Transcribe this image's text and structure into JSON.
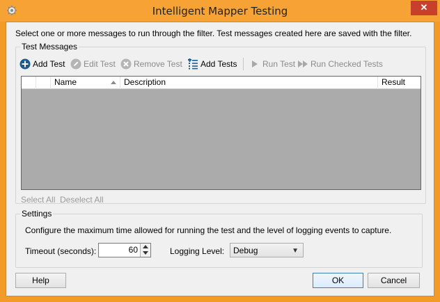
{
  "window": {
    "title": "Intelligent Mapper Testing",
    "close_glyph": "✕"
  },
  "intro_text": "Select one or more messages to run through the filter. Test messages created here are saved with the filter.",
  "test_messages": {
    "group_title": "Test Messages",
    "toolbar": {
      "add_test": "Add Test",
      "edit_test": "Edit Test",
      "remove_test": "Remove Test",
      "add_tests": "Add Tests",
      "run_test": "Run Test",
      "run_checked_tests": "Run Checked Tests"
    },
    "columns": {
      "name": "Name",
      "description": "Description",
      "result": "Result"
    },
    "rows": [],
    "select_all": "Select All",
    "deselect_all": "Deselect All"
  },
  "settings": {
    "group_title": "Settings",
    "description": "Configure the maximum time allowed for running the test and the level of logging events to capture.",
    "timeout_label": "Timeout (seconds):",
    "timeout_value": "60",
    "logging_label": "Logging Level:",
    "logging_value": "Debug"
  },
  "buttons": {
    "help": "Help",
    "ok": "OK",
    "cancel": "Cancel"
  },
  "icons": {
    "app": "gear-app-icon",
    "add": "plus-circle-icon",
    "edit": "pencil-icon",
    "remove": "x-circle-icon",
    "add_multiple": "list-add-icon",
    "run": "play-icon",
    "run_all": "fast-forward-icon"
  },
  "colors": {
    "title_bar": "#f7a234",
    "close_button": "#c7402b",
    "grid_background": "#ababab",
    "accent_blue": "#1e5a8c"
  }
}
